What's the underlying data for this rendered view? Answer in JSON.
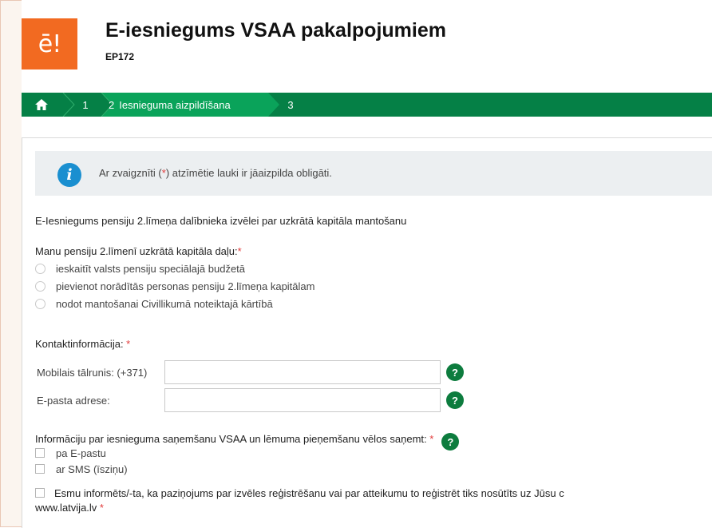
{
  "header": {
    "logo_text": "ē!",
    "title": "E-iesniegums VSAA pakalpojumiem",
    "code": "EP172"
  },
  "stepper": {
    "home_icon": "home-icon",
    "steps": [
      {
        "number": "1",
        "label": ""
      },
      {
        "number": "2",
        "label": "Iesnieguma aizpildīšana"
      },
      {
        "number": "3",
        "label": ""
      }
    ],
    "active_index": 1
  },
  "info": {
    "icon": "info-icon",
    "text_before": "Ar zvaigznīti (",
    "star": "*",
    "text_after": ") atzīmētie lauki ir jāaizpilda obligāti."
  },
  "form": {
    "section_title": "E-Iesniegums pensiju 2.līmeņa dalībnieka izvēlei par uzkrātā kapitāla mantošanu",
    "capital_question": "Manu pensiju 2.līmenī uzkrātā kapitāla daļu:",
    "required_mark": "*",
    "capital_options": [
      "ieskaitīt valsts pensiju speciālajā budžetā",
      "pievienot norādītās personas pensiju 2.līmeņa kapitālam",
      "nodot mantošanai Civillikumā noteiktajā kārtībā"
    ],
    "contact_label": "Kontaktinformācija: ",
    "phone_label": "Mobilais tālrunis: (+371)",
    "phone_value": "",
    "email_label": "E-pasta adrese:",
    "email_value": "",
    "help_symbol": "?",
    "notify_label": "Informāciju par iesnieguma saņemšanu VSAA un lēmuma pieņemšanu vēlos saņemt: ",
    "notify_options": [
      "pa E-pastu",
      "ar SMS (īsziņu)"
    ],
    "consent_line1": "Esmu informēts/-ta, ka paziņojums par izvēles reģistrēšanu vai par atteikumu to reģistrēt tiks nosūtīts uz Jūsu c",
    "consent_line2": "www.latvija.lv "
  },
  "colors": {
    "brand_orange": "#f26a21",
    "stepper_green": "#058046",
    "active_step_green": "#0aa35a",
    "help_green": "#0d7c3e",
    "info_blue": "#1a8fd0",
    "required_red": "#e23b3b"
  }
}
